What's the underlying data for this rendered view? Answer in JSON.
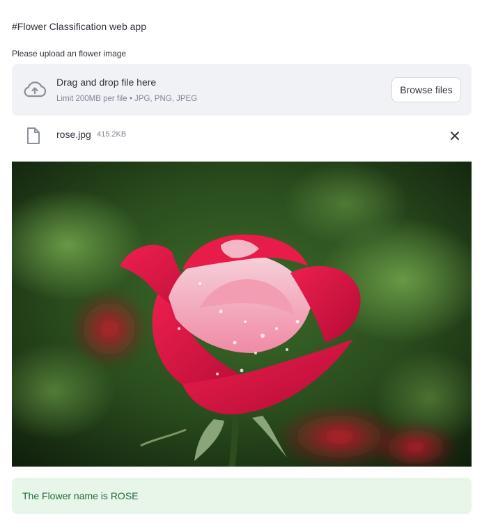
{
  "app": {
    "title": "#Flower Classification web app"
  },
  "uploader": {
    "label": "Please upload an flower image",
    "drop_text": "Drag and drop file here",
    "limit_text": "Limit 200MB per file • JPG, PNG, JPEG",
    "browse_label": "Browse files",
    "upload_icon": "cloud-upload-icon"
  },
  "uploaded_file": {
    "name": "rose.jpg",
    "size": "415.2KB",
    "file_icon": "file-icon",
    "remove_icon": "close-icon"
  },
  "image": {
    "subject": "rose-photo"
  },
  "result": {
    "text": "The Flower name is ROSE",
    "color": "#1f6b36",
    "background": "#e8f6ea"
  },
  "colors": {
    "dropzone_bg": "#f0f2f6",
    "muted_text": "#808495",
    "body_text": "#31333f"
  }
}
